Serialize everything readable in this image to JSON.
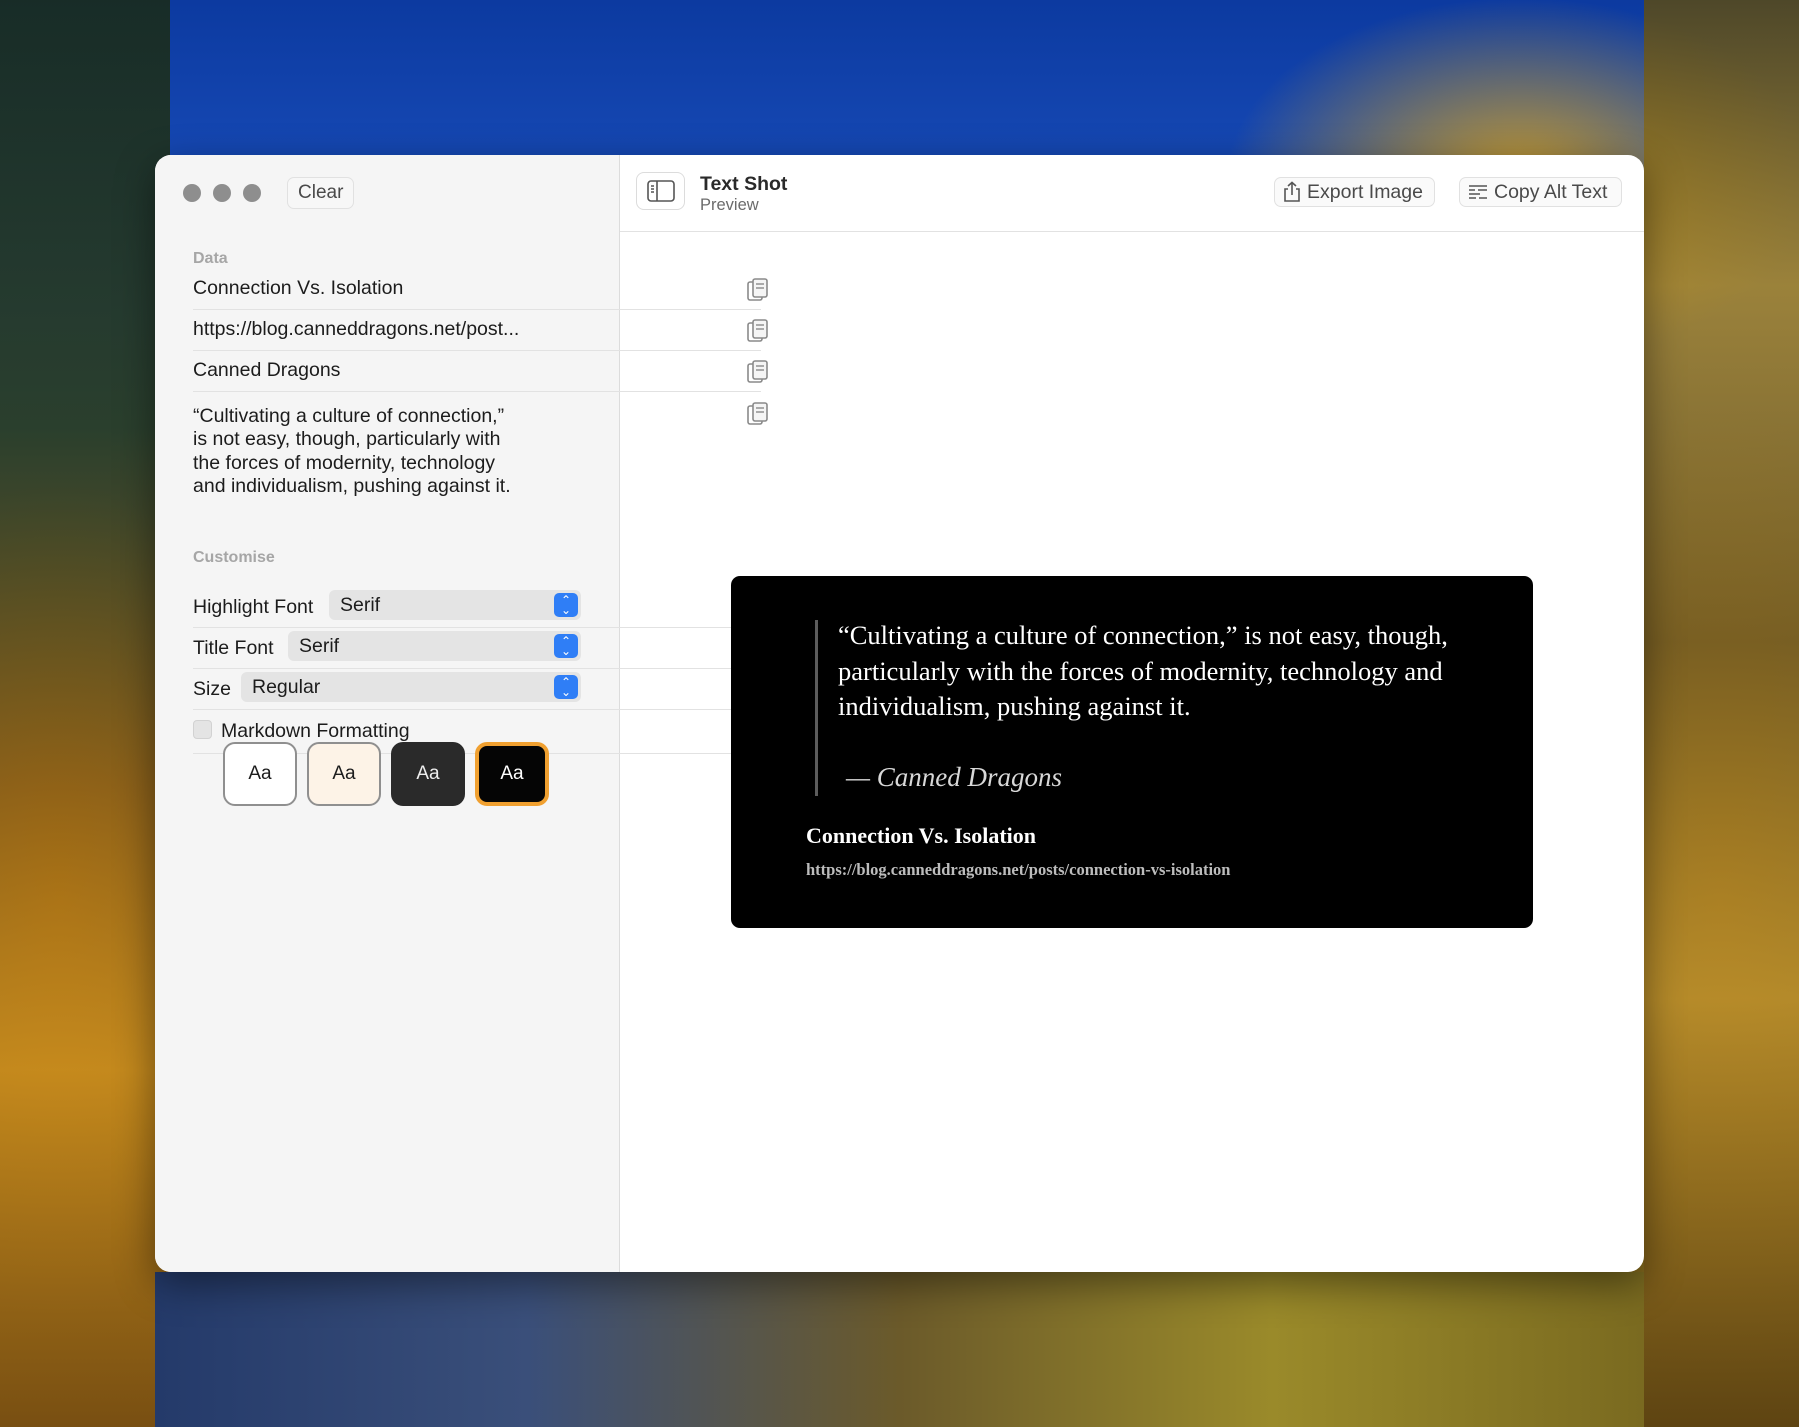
{
  "window": {
    "clear_label": "Clear",
    "title": "Text Shot",
    "subtitle": "Preview"
  },
  "toolbar": {
    "export_label": "Export Image",
    "copy_alt_label": "Copy Alt Text"
  },
  "sidebar": {
    "data_section": "Data",
    "title_value": "Connection Vs. Isolation",
    "url_value": "https://blog.canneddragons.net/post...",
    "author_value": "Canned Dragons",
    "quote_value": "“Cultivating a culture of connection,” is not easy, though, particularly with the forces of modernity, technology and individualism, pushing against it.",
    "customise_section": "Customise",
    "highlight_font_label": "Highlight Font",
    "highlight_font_value": "Serif",
    "title_font_label": "Title Font",
    "title_font_value": "Serif",
    "size_label": "Size",
    "size_value": "Regular",
    "markdown_label": "Markdown Formatting",
    "markdown_checked": false,
    "themes": [
      {
        "label": "Aa",
        "name": "light"
      },
      {
        "label": "Aa",
        "name": "cream"
      },
      {
        "label": "Aa",
        "name": "dark"
      },
      {
        "label": "Aa",
        "name": "black",
        "selected": true
      }
    ]
  },
  "preview": {
    "quote": "“Cultivating a culture of connection,” is not easy, though, particularly with the forces of modernity, technology and individualism, pushing against it.",
    "attribution": "— Canned Dragons",
    "title": "Connection Vs. Isolation",
    "url": "https://blog.canneddragons.net/posts/connection-vs-isolation"
  },
  "colors": {
    "accent": "#2f7ef6",
    "selected_theme_border": "#f0a030",
    "card_background": "#000000"
  }
}
